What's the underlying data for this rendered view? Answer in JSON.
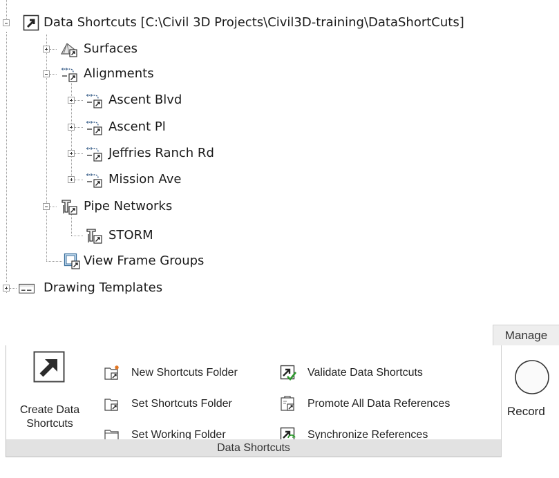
{
  "tree": {
    "root_label": "Data Shortcuts [C:\\Civil 3D Projects\\Civil3D-training\\DataShortCuts]",
    "surfaces": "Surfaces",
    "alignments": "Alignments",
    "alignment_items": [
      "Ascent Blvd",
      "Ascent Pl",
      "Jeffries Ranch Rd",
      "Mission Ave"
    ],
    "pipe_networks": "Pipe Networks",
    "pipe_items": [
      "STORM"
    ],
    "view_frame_groups": "View Frame Groups",
    "drawing_templates": "Drawing Templates"
  },
  "ribbon": {
    "tab_label": "Manage",
    "panel_title": "Data Shortcuts",
    "create_button": {
      "line1": "Create Data",
      "line2": "Shortcuts"
    },
    "left_commands": [
      "New Shortcuts Folder",
      "Set Shortcuts Folder",
      "Set Working Folder"
    ],
    "right_commands": [
      "Validate Data Shortcuts",
      "Promote All Data References",
      "Synchronize References"
    ],
    "record_label": "Record"
  }
}
